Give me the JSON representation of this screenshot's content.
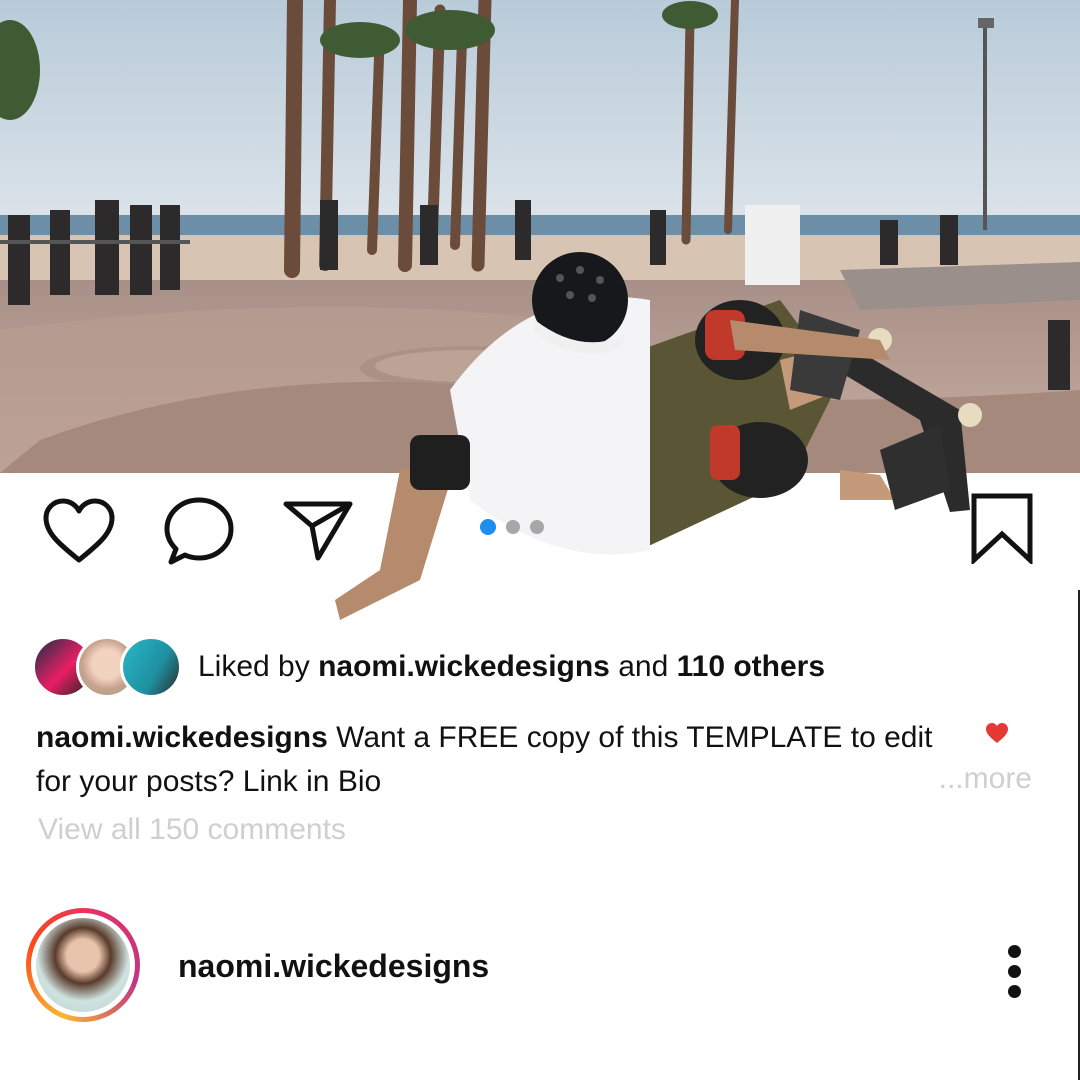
{
  "post": {
    "photo_icon": "skatepark-photo",
    "carousel": {
      "count": 3,
      "active_index": 0,
      "active_color": "#1d8ff0",
      "inactive_color": "#a7a7a7"
    },
    "actions": [
      "heart-icon",
      "comment-icon",
      "share-icon",
      "bookmark-icon"
    ],
    "likes": {
      "prefix": "Liked by",
      "user": "naomi.wickedesigns",
      "middle": "and",
      "others": "110 others"
    },
    "caption": {
      "user": "naomi.wickedesigns",
      "text": "Want a FREE copy of this TEMPLATE to edit for your posts? Link in Bio",
      "more_label": "...more",
      "liked_heart_color": "#e53935"
    },
    "view_comments_label": "View all 150 comments",
    "author": {
      "username": "naomi.wickedesigns",
      "menu_icon": "more-vertical-icon"
    }
  }
}
